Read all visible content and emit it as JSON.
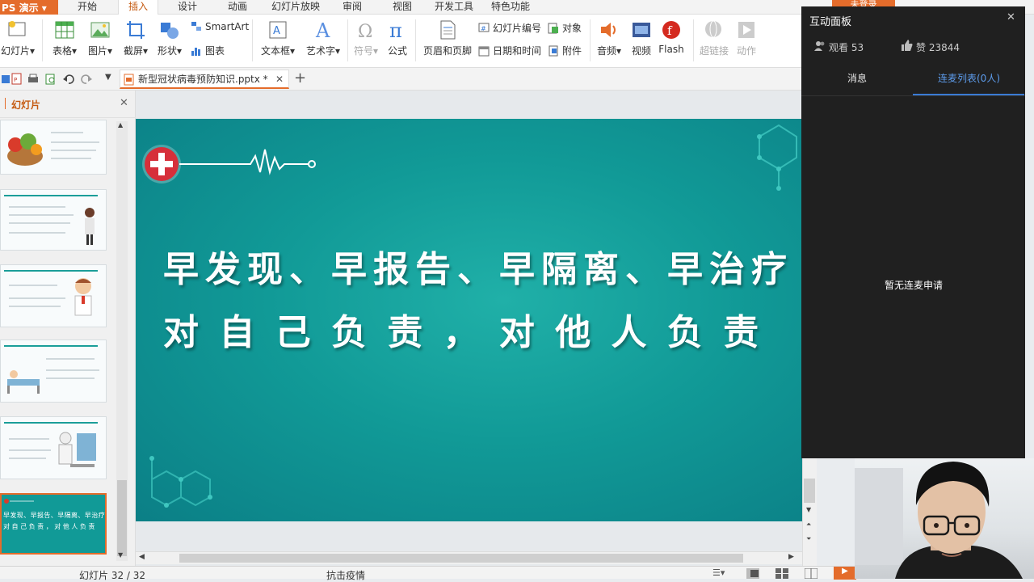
{
  "menubar": {
    "app_name": "PS 演示",
    "items": [
      "开始",
      "插入",
      "设计",
      "动画",
      "幻灯片放映",
      "审阅",
      "视图",
      "开发工具",
      "特色功能"
    ],
    "active": "插入",
    "login": "未登录"
  },
  "ribbon": {
    "slide": "幻灯片",
    "table": "表格",
    "picture": "图片",
    "screenshot": "截屏",
    "shape": "形状",
    "smartart": "SmartArt",
    "chart": "图表",
    "textbox": "文本框",
    "wordart": "艺术字",
    "symbol": "符号",
    "formula": "公式",
    "header_footer": "页眉和页脚",
    "slide_number": "幻灯片编号",
    "datetime": "日期和时间",
    "object": "对象",
    "attachment": "附件",
    "audio": "音频",
    "video": "视频",
    "flash": "Flash",
    "hyperlink": "超链接",
    "action": "动作"
  },
  "doc_tab": {
    "name": "新型冠状病毒预防知识.pptx *"
  },
  "slide_panel": {
    "title": "幻灯片",
    "current_thumb_line1": "早发现、早报告、早隔离、早治疗",
    "current_thumb_line2": "对 自 己 负 责 ， 对 他 人 负 责"
  },
  "slide": {
    "line1": "早发现、早报告、早隔离、早治疗",
    "line2": "对 自 己 负 责 ， 对 他 人 负 责"
  },
  "statusbar": {
    "slide_counter": "幻灯片 32 / 32",
    "theme": "抗击疫情"
  },
  "interaction_panel": {
    "title": "互动面板",
    "viewers": "观看 53",
    "likes": "赞 23844",
    "tab_messages": "消息",
    "tab_connect": "连麦列表(0人)",
    "empty_text": "暂无连麦申请"
  },
  "colors": {
    "accent": "#e46c2b",
    "slide_teal": "#119a97",
    "panel_bg": "#202020",
    "tab_blue": "#3a7bd5"
  }
}
